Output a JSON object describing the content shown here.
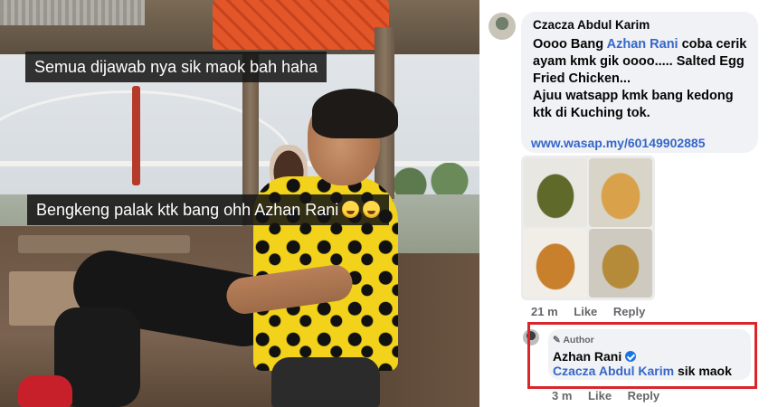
{
  "photo": {
    "caption_top": "Semua dijawab nya sik maok bah haha",
    "caption_bottom": "Bengkeng palak ktk bang ohh Azhan Rani"
  },
  "comment": {
    "author": "Czacza Abdul Karim",
    "line_prefix": "Oooo Bang ",
    "mention": "Azhan Rani",
    "line_suffix": "  coba cerik ayam kmk gik oooo..... Salted Egg Fried Chicken...",
    "line2": "Ajuu watsapp kmk bang kedong ktk di Kuching tok.",
    "link": "www.wasap.my/60149902885",
    "time": "21 m",
    "like": "Like",
    "reply": "Reply"
  },
  "reply": {
    "tag": "Author",
    "author": "Azhan Rani",
    "mention": "Czacza Abdul Karim",
    "text": " sik maok",
    "time": "3 m",
    "like": "Like",
    "reply": "Reply"
  },
  "colors": {
    "accent": "#3567c9",
    "highlight": "#d9262b",
    "bubble": "#f0f2f5"
  }
}
